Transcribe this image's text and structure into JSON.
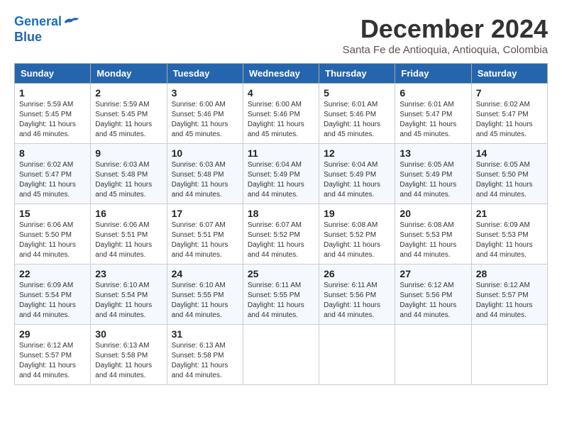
{
  "header": {
    "logo_line1": "General",
    "logo_line2": "Blue",
    "month": "December 2024",
    "location": "Santa Fe de Antioquia, Antioquia, Colombia"
  },
  "days_of_week": [
    "Sunday",
    "Monday",
    "Tuesday",
    "Wednesday",
    "Thursday",
    "Friday",
    "Saturday"
  ],
  "weeks": [
    [
      {
        "day": "1",
        "sunrise": "5:59 AM",
        "sunset": "5:45 PM",
        "daylight": "11 hours and 46 minutes."
      },
      {
        "day": "2",
        "sunrise": "5:59 AM",
        "sunset": "5:45 PM",
        "daylight": "11 hours and 45 minutes."
      },
      {
        "day": "3",
        "sunrise": "6:00 AM",
        "sunset": "5:46 PM",
        "daylight": "11 hours and 45 minutes."
      },
      {
        "day": "4",
        "sunrise": "6:00 AM",
        "sunset": "5:46 PM",
        "daylight": "11 hours and 45 minutes."
      },
      {
        "day": "5",
        "sunrise": "6:01 AM",
        "sunset": "5:46 PM",
        "daylight": "11 hours and 45 minutes."
      },
      {
        "day": "6",
        "sunrise": "6:01 AM",
        "sunset": "5:47 PM",
        "daylight": "11 hours and 45 minutes."
      },
      {
        "day": "7",
        "sunrise": "6:02 AM",
        "sunset": "5:47 PM",
        "daylight": "11 hours and 45 minutes."
      }
    ],
    [
      {
        "day": "8",
        "sunrise": "6:02 AM",
        "sunset": "5:47 PM",
        "daylight": "11 hours and 45 minutes."
      },
      {
        "day": "9",
        "sunrise": "6:03 AM",
        "sunset": "5:48 PM",
        "daylight": "11 hours and 45 minutes."
      },
      {
        "day": "10",
        "sunrise": "6:03 AM",
        "sunset": "5:48 PM",
        "daylight": "11 hours and 44 minutes."
      },
      {
        "day": "11",
        "sunrise": "6:04 AM",
        "sunset": "5:49 PM",
        "daylight": "11 hours and 44 minutes."
      },
      {
        "day": "12",
        "sunrise": "6:04 AM",
        "sunset": "5:49 PM",
        "daylight": "11 hours and 44 minutes."
      },
      {
        "day": "13",
        "sunrise": "6:05 AM",
        "sunset": "5:49 PM",
        "daylight": "11 hours and 44 minutes."
      },
      {
        "day": "14",
        "sunrise": "6:05 AM",
        "sunset": "5:50 PM",
        "daylight": "11 hours and 44 minutes."
      }
    ],
    [
      {
        "day": "15",
        "sunrise": "6:06 AM",
        "sunset": "5:50 PM",
        "daylight": "11 hours and 44 minutes."
      },
      {
        "day": "16",
        "sunrise": "6:06 AM",
        "sunset": "5:51 PM",
        "daylight": "11 hours and 44 minutes."
      },
      {
        "day": "17",
        "sunrise": "6:07 AM",
        "sunset": "5:51 PM",
        "daylight": "11 hours and 44 minutes."
      },
      {
        "day": "18",
        "sunrise": "6:07 AM",
        "sunset": "5:52 PM",
        "daylight": "11 hours and 44 minutes."
      },
      {
        "day": "19",
        "sunrise": "6:08 AM",
        "sunset": "5:52 PM",
        "daylight": "11 hours and 44 minutes."
      },
      {
        "day": "20",
        "sunrise": "6:08 AM",
        "sunset": "5:53 PM",
        "daylight": "11 hours and 44 minutes."
      },
      {
        "day": "21",
        "sunrise": "6:09 AM",
        "sunset": "5:53 PM",
        "daylight": "11 hours and 44 minutes."
      }
    ],
    [
      {
        "day": "22",
        "sunrise": "6:09 AM",
        "sunset": "5:54 PM",
        "daylight": "11 hours and 44 minutes."
      },
      {
        "day": "23",
        "sunrise": "6:10 AM",
        "sunset": "5:54 PM",
        "daylight": "11 hours and 44 minutes."
      },
      {
        "day": "24",
        "sunrise": "6:10 AM",
        "sunset": "5:55 PM",
        "daylight": "11 hours and 44 minutes."
      },
      {
        "day": "25",
        "sunrise": "6:11 AM",
        "sunset": "5:55 PM",
        "daylight": "11 hours and 44 minutes."
      },
      {
        "day": "26",
        "sunrise": "6:11 AM",
        "sunset": "5:56 PM",
        "daylight": "11 hours and 44 minutes."
      },
      {
        "day": "27",
        "sunrise": "6:12 AM",
        "sunset": "5:56 PM",
        "daylight": "11 hours and 44 minutes."
      },
      {
        "day": "28",
        "sunrise": "6:12 AM",
        "sunset": "5:57 PM",
        "daylight": "11 hours and 44 minutes."
      }
    ],
    [
      {
        "day": "29",
        "sunrise": "6:12 AM",
        "sunset": "5:57 PM",
        "daylight": "11 hours and 44 minutes."
      },
      {
        "day": "30",
        "sunrise": "6:13 AM",
        "sunset": "5:58 PM",
        "daylight": "11 hours and 44 minutes."
      },
      {
        "day": "31",
        "sunrise": "6:13 AM",
        "sunset": "5:58 PM",
        "daylight": "11 hours and 44 minutes."
      },
      null,
      null,
      null,
      null
    ]
  ],
  "labels": {
    "sunrise": "Sunrise:",
    "sunset": "Sunset:",
    "daylight": "Daylight:"
  }
}
